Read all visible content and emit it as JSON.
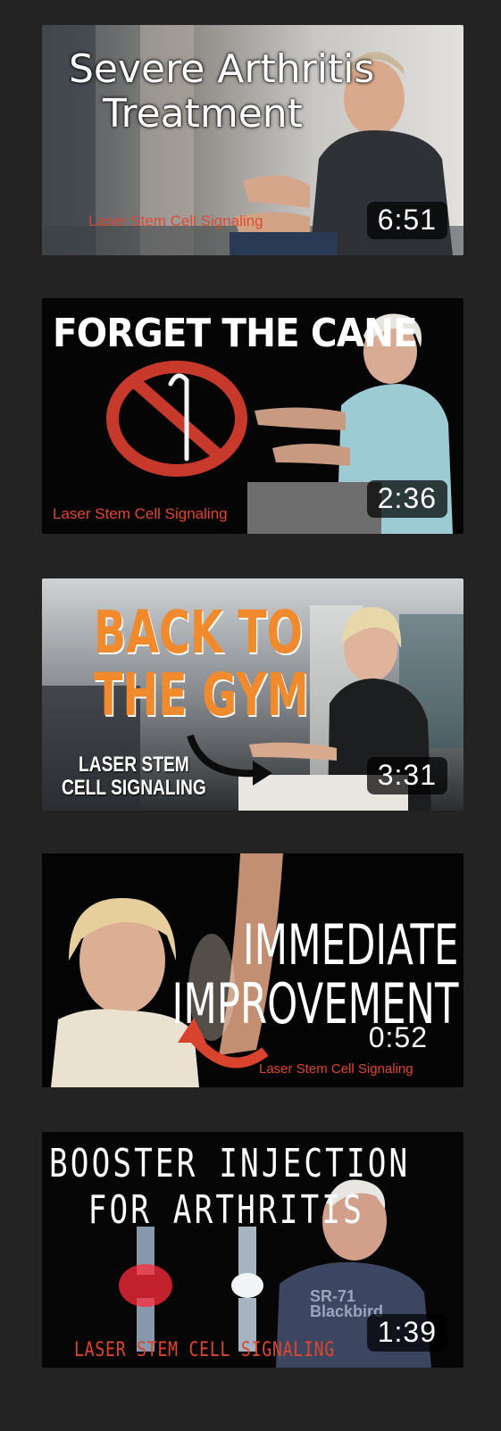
{
  "videos": [
    {
      "title": "Severe Arthritis Treatment",
      "headline_line1": "Severe Arthritis",
      "headline_line2": "Treatment",
      "brand": "Laser Stem Cell Signaling",
      "duration": "6:51"
    },
    {
      "title": "FORGET THE CANE",
      "headline_line1": "FORGET THE CANE",
      "brand": "Laser Stem Cell Signaling",
      "duration": "2:36"
    },
    {
      "title": "BACK TO THE GYM",
      "headline_line1": "BACK TO",
      "headline_line2": "THE GYM",
      "brand_line1": "LASER STEM",
      "brand_line2": "CELL SIGNALING",
      "duration": "3:31"
    },
    {
      "title": "IMMEDIATE IMPROVEMENT",
      "headline_line1": "IMMEDIATE",
      "headline_line2": "IMPROVEMENT",
      "brand": "Laser Stem Cell Signaling",
      "duration": "0:52"
    },
    {
      "title": "BOOSTER INJECTION FOR ARTHRITIS",
      "headline_line1": "BOOSTER INJECTION",
      "headline_line2": "FOR ARTHRITIS",
      "brand": "LASER STEM CELL SIGNALING",
      "badge_text": "SR-71 Blackbird",
      "duration": "1:39"
    }
  ],
  "colors": {
    "page_bg": "#232323",
    "brand_red": "#e0452f",
    "gym_orange": "#f08a2c",
    "duration_bg": "rgba(0,0,0,0.72)"
  },
  "icons": [
    "no-cane-icon",
    "curved-arrow-icon",
    "red-arrow-icon",
    "knee-xray-icon"
  ]
}
